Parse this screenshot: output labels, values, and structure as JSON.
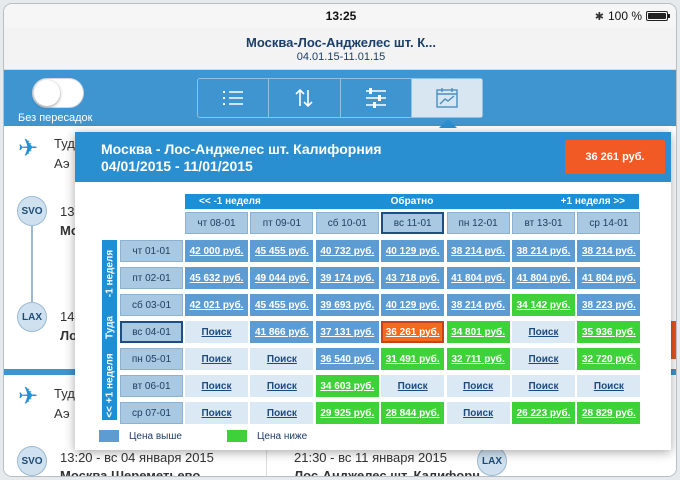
{
  "status": {
    "time": "13:25",
    "battery": "100 %"
  },
  "header": {
    "title": "Москва-Лос-Анджелес шт. К...",
    "dates": "04.01.15-11.01.15"
  },
  "toolbar": {
    "nonstop_label": "Без пересадок"
  },
  "background": {
    "seg1_title": "Туда",
    "seg1_airline": "Аэ",
    "origin_code": "SVO",
    "origin_time": "13",
    "origin_city": "Мо",
    "dest_code": "LAX",
    "dest_time": "14",
    "dest_city": "Ло",
    "seg2_title": "Туд",
    "seg2_airline": "Аэ",
    "row_code_left": "SVO",
    "row_code_right": "LAX",
    "row_left_time": "13:20 - вс 04 января 2015",
    "row_right_time": "21:30 - вс 11 января 2015",
    "row_left_city": "Москва Шереметьево",
    "row_right_city": "Лос-Анджелес шт. Калифорн"
  },
  "popover": {
    "title_line1": "Москва - Лос-Анджелес шт. Калифорния",
    "title_line2": "04/01/2015 - 11/01/2015",
    "price": "36 261 руб.",
    "back_label": "Обратно",
    "prev_week": "<< -1 неделя",
    "next_week": "+1 неделя >>",
    "forward_label": "Туда",
    "minus_week": "-1 неделя",
    "plus_week": "<< +1 неделя",
    "columns": [
      "чт 08-01",
      "пт 09-01",
      "сб 10-01",
      "вс 11-01",
      "пн 12-01",
      "вт 13-01",
      "ср 14-01"
    ],
    "rows": [
      {
        "label": "чт 01-01",
        "cells": [
          "42 000 руб.",
          "45 455 руб.",
          "40 732 руб.",
          "40 129 руб.",
          "38 214 руб.",
          "38 214 руб.",
          "38 214 руб."
        ],
        "types": [
          "price",
          "price",
          "price",
          "price",
          "price",
          "price",
          "price"
        ]
      },
      {
        "label": "пт 02-01",
        "cells": [
          "45 632 руб.",
          "49 044 руб.",
          "39 174 руб.",
          "43 718 руб.",
          "41 804 руб.",
          "41 804 руб.",
          "41 804 руб."
        ],
        "types": [
          "price",
          "price",
          "price",
          "price",
          "price",
          "price",
          "price"
        ]
      },
      {
        "label": "сб 03-01",
        "cells": [
          "42 021 руб.",
          "45 455 руб.",
          "39 693 руб.",
          "40 129 руб.",
          "38 214 руб.",
          "34 142 руб.",
          "38 223 руб."
        ],
        "types": [
          "price",
          "price",
          "price",
          "price",
          "price",
          "green",
          "price"
        ]
      },
      {
        "label": "вс 04-01",
        "cells": [
          "Поиск",
          "41 866 руб.",
          "37 131 руб.",
          "36 261 руб.",
          "34 801 руб.",
          "Поиск",
          "35 936 руб."
        ],
        "types": [
          "search",
          "price",
          "price",
          "orange",
          "green",
          "search",
          "green"
        ]
      },
      {
        "label": "пн 05-01",
        "cells": [
          "Поиск",
          "Поиск",
          "36 540 руб.",
          "31 491 руб.",
          "32 711 руб.",
          "Поиск",
          "32 720 руб."
        ],
        "types": [
          "search",
          "search",
          "price",
          "green",
          "green",
          "search",
          "green"
        ]
      },
      {
        "label": "вт 06-01",
        "cells": [
          "Поиск",
          "Поиск",
          "34 603 руб.",
          "Поиск",
          "Поиск",
          "Поиск",
          "Поиск"
        ],
        "types": [
          "search",
          "search",
          "green",
          "search",
          "search",
          "search",
          "search"
        ]
      },
      {
        "label": "ср 07-01",
        "cells": [
          "Поиск",
          "Поиск",
          "29 925 руб.",
          "28 844 руб.",
          "Поиск",
          "26 223 руб.",
          "28 829 руб."
        ],
        "types": [
          "search",
          "search",
          "green",
          "green",
          "search",
          "green",
          "green"
        ]
      }
    ],
    "selected_column": 3,
    "selected_row": 3,
    "legend_higher": "Цена выше",
    "legend_lower": "Цена ниже"
  },
  "colors": {
    "accent": "#2a8fd0",
    "higher": "#5d9cd2",
    "lower": "#3fd13a",
    "best": "#f46a1b",
    "search": "#dbe9f5"
  },
  "icons": {
    "seg_buttons": [
      "list-icon",
      "sort-icon",
      "filter-sliders-icon",
      "calendar-chart-icon"
    ]
  }
}
